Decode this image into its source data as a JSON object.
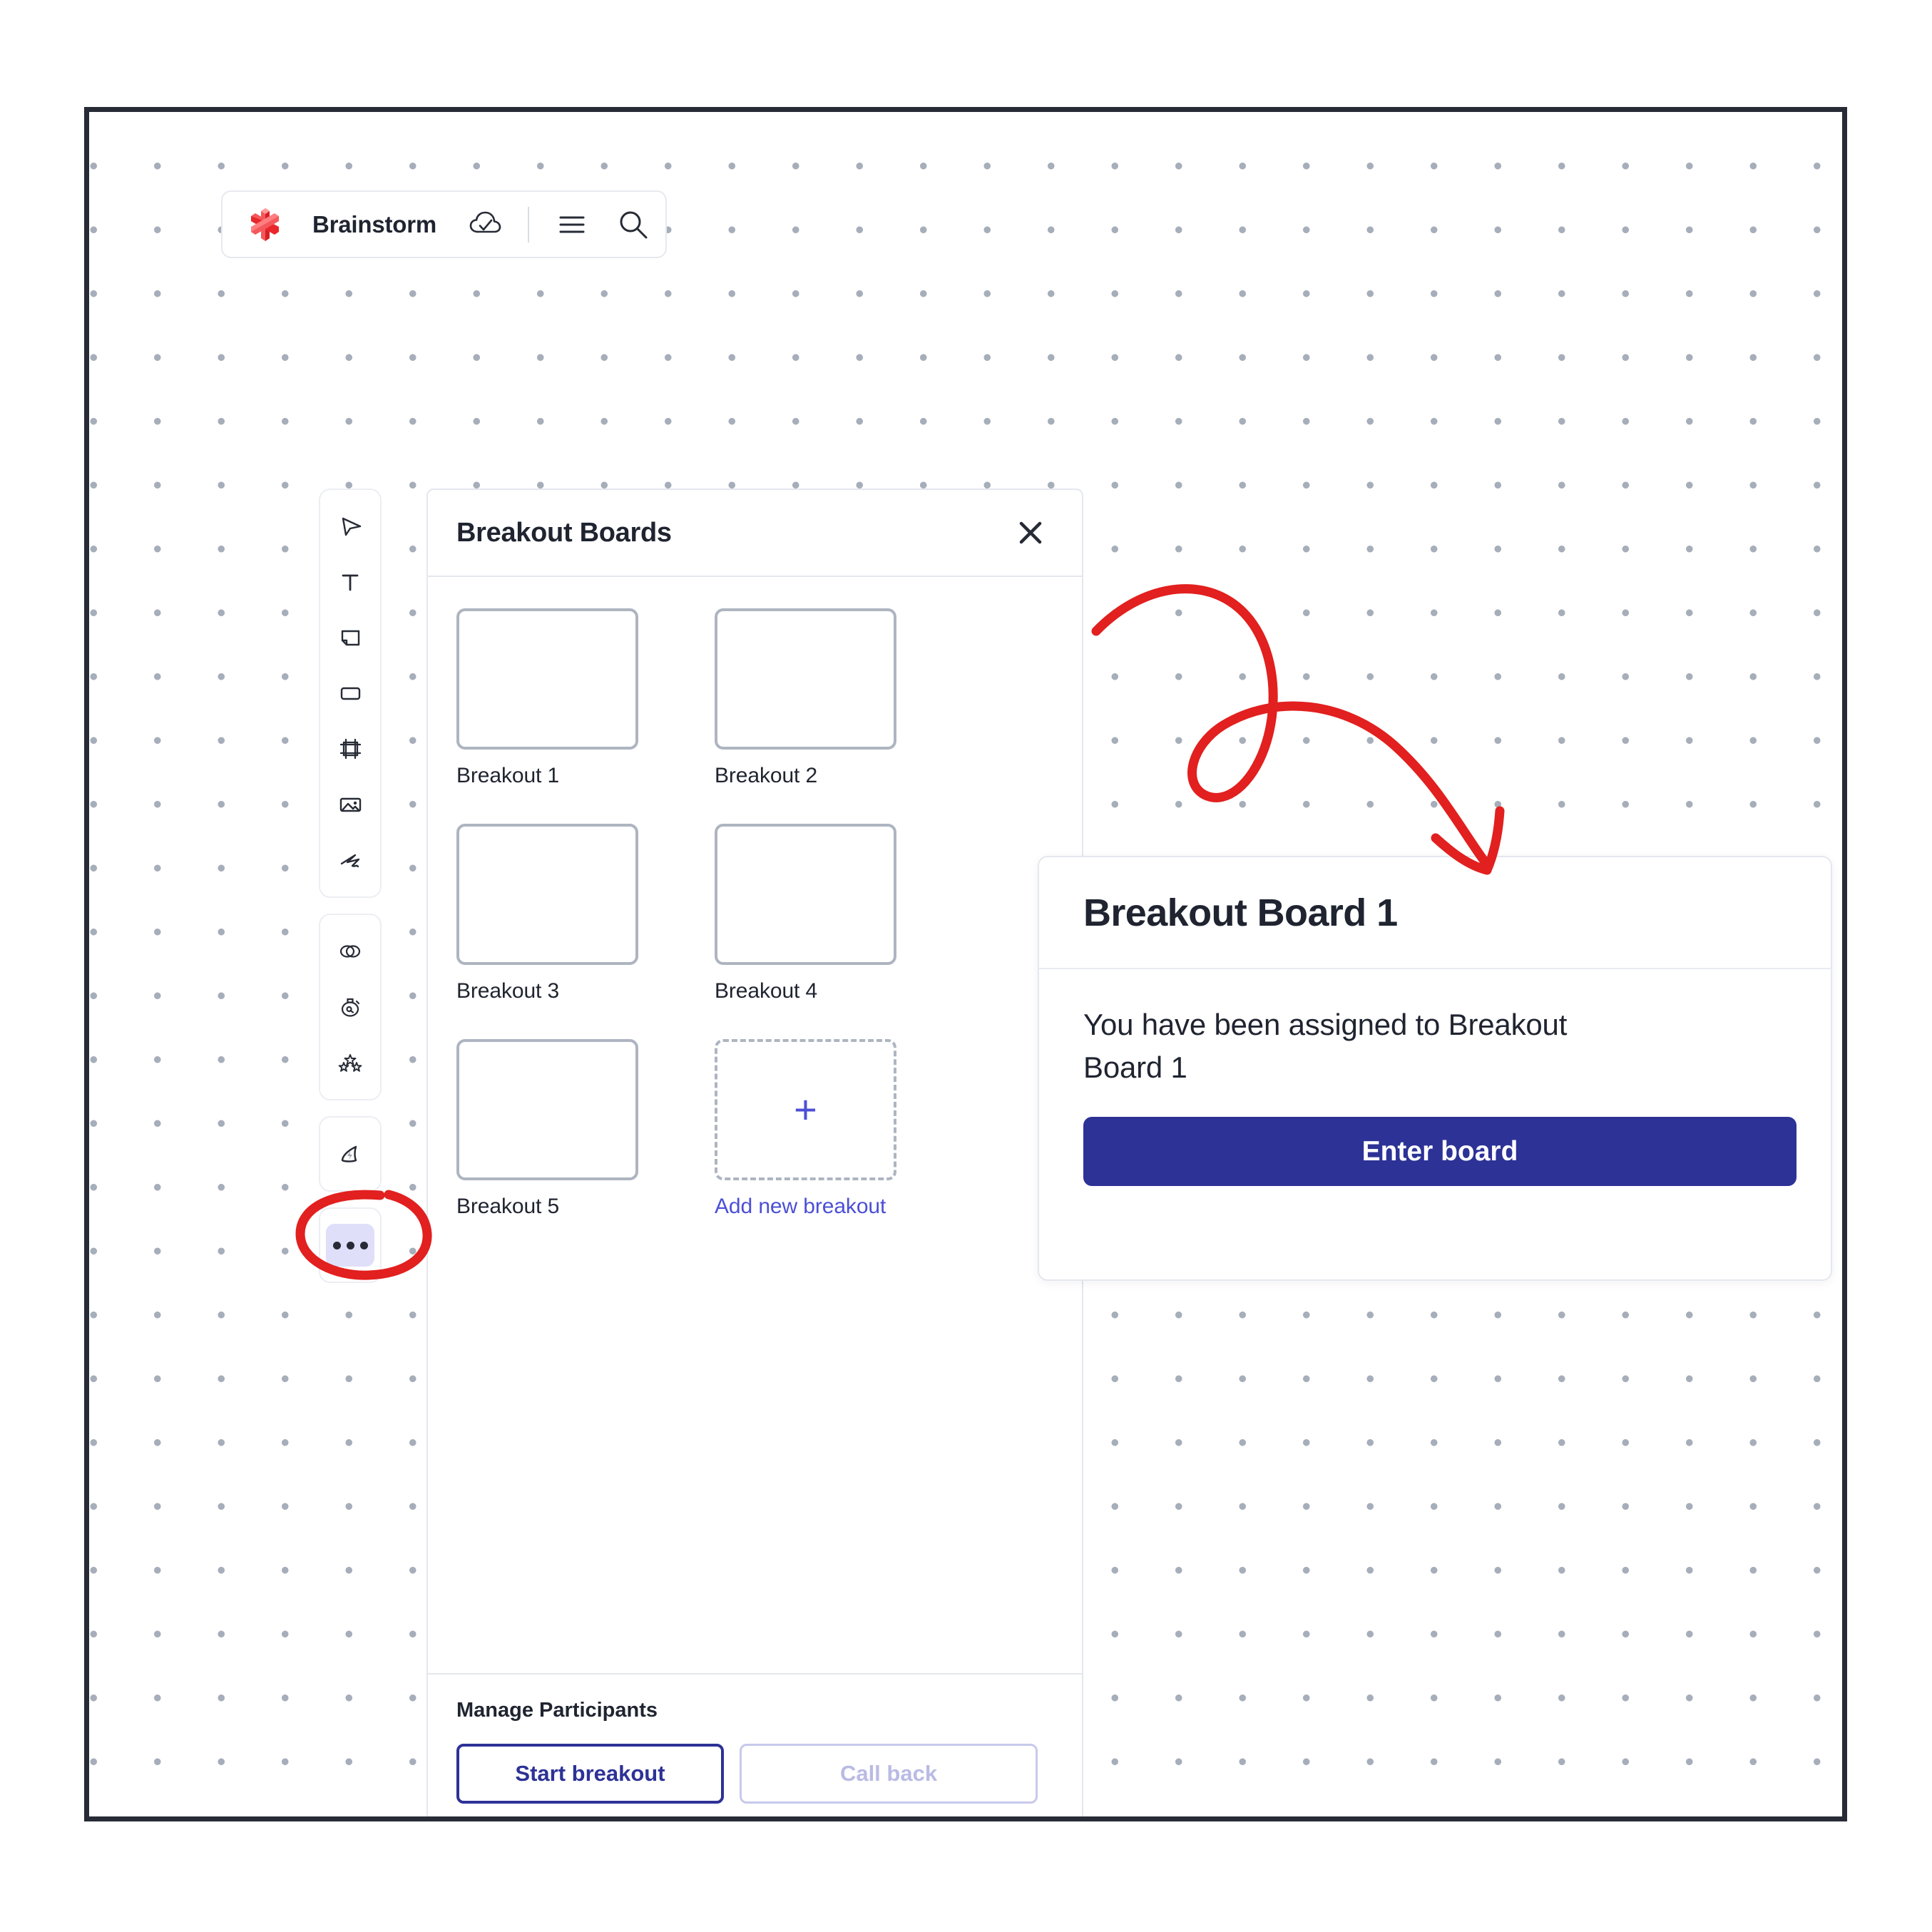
{
  "app": {
    "title": "Brainstorm",
    "logo_icon": "asterisk-logo",
    "icons": {
      "cloud_saved": "cloud-check-icon",
      "menu": "hamburger-menu-icon",
      "search": "search-icon"
    }
  },
  "toolbar": {
    "groups": [
      {
        "tools": [
          {
            "name": "select",
            "icon": "cursor-icon"
          },
          {
            "name": "text",
            "icon": "text-icon"
          },
          {
            "name": "sticky-note",
            "icon": "sticky-note-icon"
          },
          {
            "name": "shape",
            "icon": "rectangle-icon"
          },
          {
            "name": "frame",
            "icon": "frame-icon"
          },
          {
            "name": "image",
            "icon": "image-icon"
          },
          {
            "name": "pen",
            "icon": "scribble-icon"
          }
        ]
      },
      {
        "tools": [
          {
            "name": "diagram",
            "icon": "venn-icon"
          },
          {
            "name": "timer",
            "icon": "stopwatch-icon"
          },
          {
            "name": "voting",
            "icon": "stars-icon"
          }
        ]
      },
      {
        "tools": [
          {
            "name": "apps",
            "icon": "shark-fin-icon"
          }
        ]
      },
      {
        "tools": [
          {
            "name": "more",
            "icon": "ellipsis-icon",
            "active": true
          }
        ]
      }
    ]
  },
  "panel": {
    "title": "Breakout Boards",
    "close_icon": "close-icon",
    "boards": [
      {
        "label": "Breakout 1"
      },
      {
        "label": "Breakout 2"
      },
      {
        "label": "Breakout 3"
      },
      {
        "label": "Breakout 4"
      },
      {
        "label": "Breakout 5"
      }
    ],
    "add_board": {
      "label": "Add new breakout",
      "icon": "plus-icon"
    },
    "footer": {
      "title": "Manage Participants",
      "start_label": "Start breakout",
      "callback_label": "Call back"
    }
  },
  "modal": {
    "title": "Breakout Board 1",
    "message": "You have been assigned to Breakout Board 1",
    "primary_label": "Enter board"
  },
  "annotations": {
    "arrow": "red-curved-arrow",
    "ellipse": "red-ellipse-highlight"
  },
  "colors": {
    "brand_red": "#E8262B",
    "accent_indigo": "#2D3296",
    "link_blue": "#4B4FD6",
    "annotation_red": "#E1201F",
    "frame_dark": "#262B35",
    "thumb_border": "#AEB5C1"
  }
}
